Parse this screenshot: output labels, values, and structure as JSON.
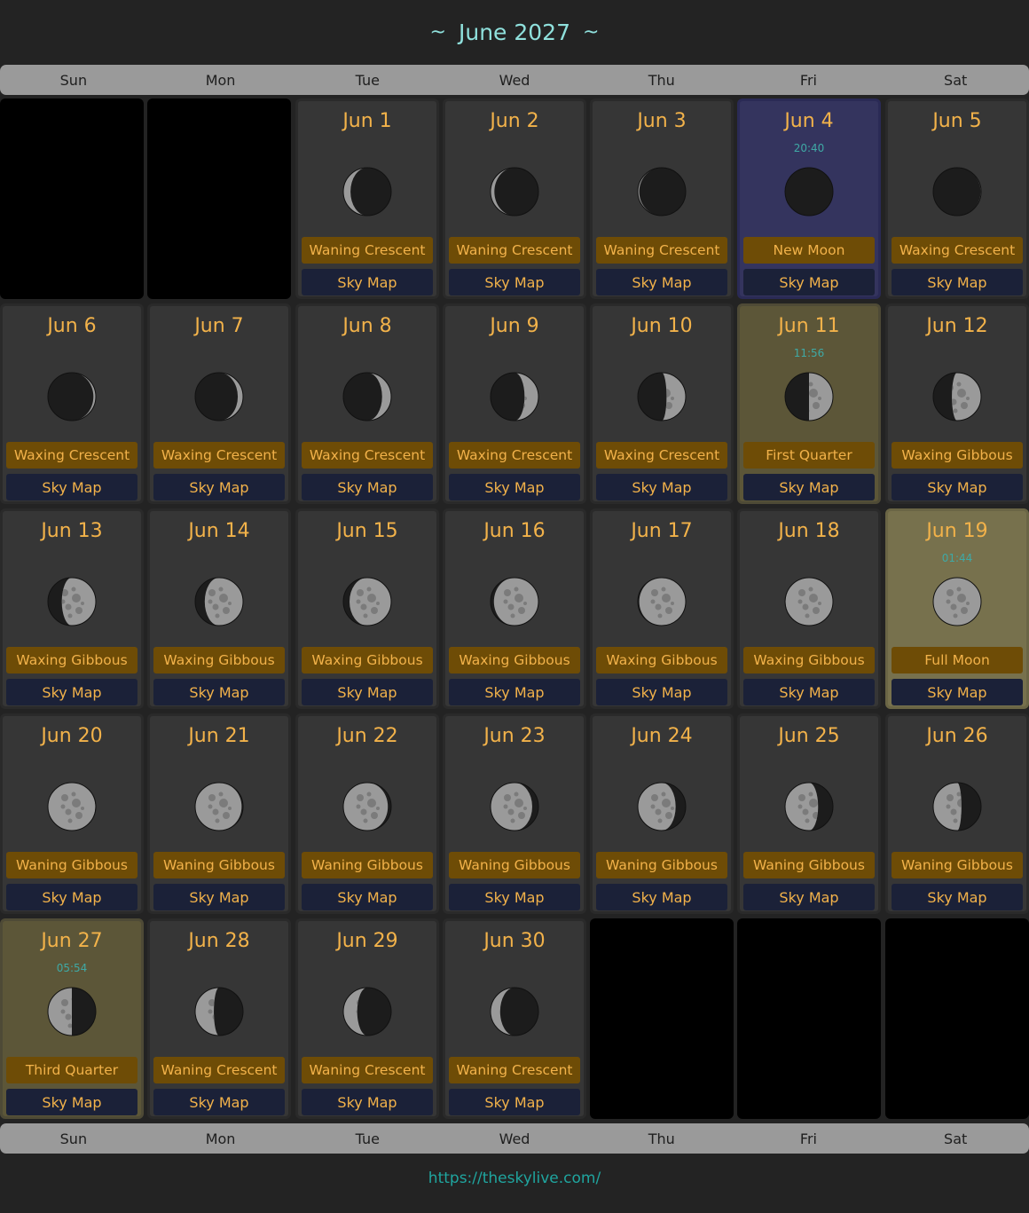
{
  "header": {
    "title": "June 2027",
    "tilde": "~"
  },
  "weekdays": [
    "Sun",
    "Mon",
    "Tue",
    "Wed",
    "Thu",
    "Fri",
    "Sat"
  ],
  "sky_map_label": "Sky Map",
  "footer": {
    "link": "https://theskylive.com/"
  },
  "colors": {
    "date": "#f2b24a",
    "title": "#8fe0dc",
    "phase_bg": "#6e4c06",
    "skymap_bg": "#1b2138",
    "newmoon_bg": "#34345e",
    "quarter_bg": "#5c5638",
    "full_bg": "#77714d"
  },
  "days": [
    {
      "date": "Jun 1",
      "phase": "Waning Crescent",
      "illum": 0.15,
      "waxing": false
    },
    {
      "date": "Jun 2",
      "phase": "Waning Crescent",
      "illum": 0.08,
      "waxing": false
    },
    {
      "date": "Jun 3",
      "phase": "Waning Crescent",
      "illum": 0.03,
      "waxing": false
    },
    {
      "date": "Jun 4",
      "phase": "New Moon",
      "time": "20:40",
      "illum": 0.0,
      "waxing": true,
      "highlight": "newmoon"
    },
    {
      "date": "Jun 5",
      "phase": "Waxing Crescent",
      "illum": 0.01,
      "waxing": true
    },
    {
      "date": "Jun 6",
      "phase": "Waxing Crescent",
      "illum": 0.05,
      "waxing": true
    },
    {
      "date": "Jun 7",
      "phase": "Waxing Crescent",
      "illum": 0.11,
      "waxing": true
    },
    {
      "date": "Jun 8",
      "phase": "Waxing Crescent",
      "illum": 0.19,
      "waxing": true
    },
    {
      "date": "Jun 9",
      "phase": "Waxing Crescent",
      "illum": 0.29,
      "waxing": true
    },
    {
      "date": "Jun 10",
      "phase": "Waxing Crescent",
      "illum": 0.4,
      "waxing": true
    },
    {
      "date": "Jun 11",
      "phase": "First Quarter",
      "time": "11:56",
      "illum": 0.5,
      "waxing": true,
      "highlight": "quarter"
    },
    {
      "date": "Jun 12",
      "phase": "Waxing Gibbous",
      "illum": 0.61,
      "waxing": true
    },
    {
      "date": "Jun 13",
      "phase": "Waxing Gibbous",
      "illum": 0.71,
      "waxing": true
    },
    {
      "date": "Jun 14",
      "phase": "Waxing Gibbous",
      "illum": 0.8,
      "waxing": true
    },
    {
      "date": "Jun 15",
      "phase": "Waxing Gibbous",
      "illum": 0.87,
      "waxing": true
    },
    {
      "date": "Jun 16",
      "phase": "Waxing Gibbous",
      "illum": 0.93,
      "waxing": true
    },
    {
      "date": "Jun 17",
      "phase": "Waxing Gibbous",
      "illum": 0.97,
      "waxing": true
    },
    {
      "date": "Jun 18",
      "phase": "Waxing Gibbous",
      "illum": 0.99,
      "waxing": true
    },
    {
      "date": "Jun 19",
      "phase": "Full Moon",
      "time": "01:44",
      "illum": 1.0,
      "waxing": true,
      "highlight": "full"
    },
    {
      "date": "Jun 20",
      "phase": "Waning Gibbous",
      "illum": 0.99,
      "waxing": false
    },
    {
      "date": "Jun 21",
      "phase": "Waning Gibbous",
      "illum": 0.97,
      "waxing": false
    },
    {
      "date": "Jun 22",
      "phase": "Waning Gibbous",
      "illum": 0.93,
      "waxing": false
    },
    {
      "date": "Jun 23",
      "phase": "Waning Gibbous",
      "illum": 0.87,
      "waxing": false
    },
    {
      "date": "Jun 24",
      "phase": "Waning Gibbous",
      "illum": 0.79,
      "waxing": false
    },
    {
      "date": "Jun 25",
      "phase": "Waning Gibbous",
      "illum": 0.69,
      "waxing": false
    },
    {
      "date": "Jun 26",
      "phase": "Waning Gibbous",
      "illum": 0.59,
      "waxing": false
    },
    {
      "date": "Jun 27",
      "phase": "Third Quarter",
      "time": "05:54",
      "illum": 0.5,
      "waxing": false,
      "highlight": "quarter"
    },
    {
      "date": "Jun 28",
      "phase": "Waning Crescent",
      "illum": 0.39,
      "waxing": false
    },
    {
      "date": "Jun 29",
      "phase": "Waning Crescent",
      "illum": 0.29,
      "waxing": false
    },
    {
      "date": "Jun 30",
      "phase": "Waning Crescent",
      "illum": 0.2,
      "waxing": false
    }
  ],
  "leading_empty": 2
}
